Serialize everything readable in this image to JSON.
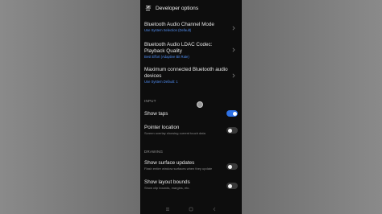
{
  "header": {
    "title": "Developer options",
    "back_icon": "zz-logo-icon"
  },
  "items": [
    {
      "title": "Bluetooth Audio Channel Mode",
      "subtitle": "Use System Selection (Default)"
    },
    {
      "title": "Bluetooth Audio LDAC Codec: Playback Quality",
      "subtitle": "Best Effort (Adaptive Bit Rate)"
    },
    {
      "title": "Maximum connected Bluetooth audio devices",
      "subtitle": "Use System Default: 1"
    }
  ],
  "sections": {
    "input": "INPUT",
    "drawing": "DRAWING"
  },
  "toggles": [
    {
      "title": "Show taps",
      "state": "on"
    },
    {
      "title": "Pointer location",
      "description": "Screen overlay showing current touch data",
      "state": "off"
    },
    {
      "title": "Show surface updates",
      "description": "Flash entire window surfaces when they update",
      "state": "off"
    },
    {
      "title": "Show layout bounds",
      "description": "Show clip bounds, margins, etc.",
      "state": "off"
    }
  ],
  "colors": {
    "accent": "#2f72e6",
    "subtitle": "#4f8cf0",
    "background": "#0d0d0d"
  },
  "nav_icons": [
    "menu-icon",
    "home-icon",
    "back-icon"
  ]
}
